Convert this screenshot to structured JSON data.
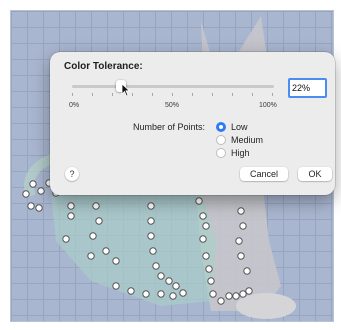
{
  "dialog": {
    "title": "Color Tolerance:",
    "slider": {
      "value_percent": 22,
      "min_label": "0%",
      "mid_label": "50%",
      "max_label": "100%"
    },
    "tolerance_value": "22%",
    "points_label": "Number of Points:",
    "options": [
      {
        "label": "Low",
        "selected": true
      },
      {
        "label": "Medium",
        "selected": false
      },
      {
        "label": "High",
        "selected": false
      }
    ],
    "help_label": "?",
    "cancel_label": "Cancel",
    "ok_label": "OK"
  },
  "colors": {
    "accent": "#2f7bf6",
    "canvas": "#a9b6cf",
    "dialog_bg": "#ececec"
  }
}
